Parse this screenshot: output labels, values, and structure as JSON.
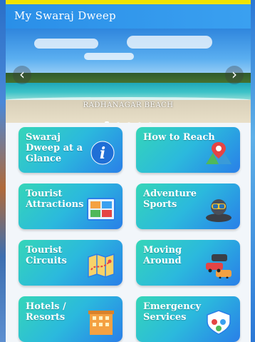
{
  "app": {
    "title": "My Swaraj Dweep"
  },
  "carousel": {
    "caption": "RADHANAGAR BEACH",
    "prev_glyph": "‹",
    "next_glyph": "›",
    "slide_count": 5,
    "active_index": 0
  },
  "tiles": [
    {
      "label": "Swaraj Dweep at a Glance",
      "icon": "info-icon"
    },
    {
      "label": "How to Reach",
      "icon": "map-pin-icon"
    },
    {
      "label": "Tourist Attractions",
      "icon": "gallery-icon"
    },
    {
      "label": "Adventure Sports",
      "icon": "diver-icon"
    },
    {
      "label": "Tourist Circuits",
      "icon": "folded-map-icon"
    },
    {
      "label": "Moving Around",
      "icon": "vehicles-icon"
    },
    {
      "label": "Hotels / Resorts",
      "icon": "hotel-icon"
    },
    {
      "label": "Emergency Services",
      "icon": "emergency-icon"
    }
  ],
  "colors": {
    "appbar": "#2a8fe8",
    "tile_start": "#35d6b8",
    "tile_end": "#2a7fe8",
    "top_strip": "#f1e300"
  }
}
